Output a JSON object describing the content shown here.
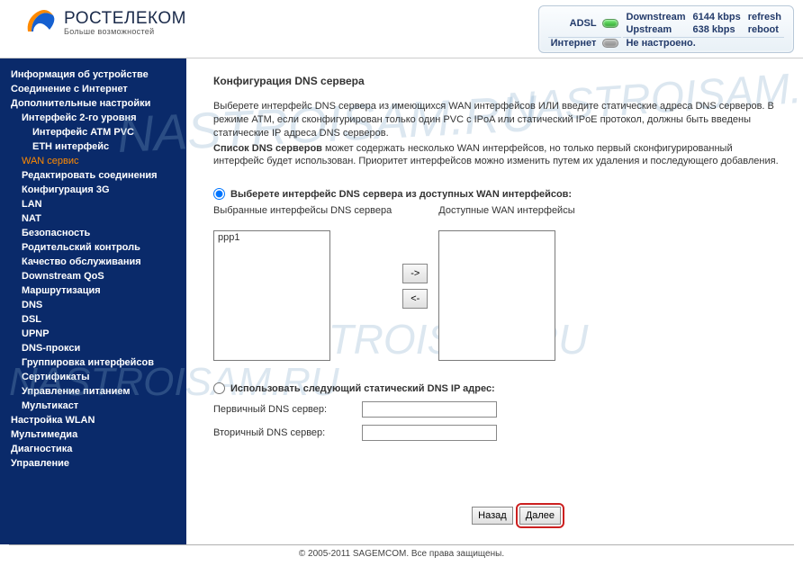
{
  "brand": {
    "title": "РОСТЕЛЕКОМ",
    "subtitle": "Больше возможностей"
  },
  "status": {
    "adsl_label": "ADSL",
    "downstream_label": "Downstream",
    "downstream_value": "6144 kbps",
    "upstream_label": "Upstream",
    "upstream_value": "638 kbps",
    "internet_label": "Интернет",
    "internet_value": "Не настроено.",
    "refresh": "refresh",
    "reboot": "reboot"
  },
  "sidebar": {
    "items": [
      {
        "label": "Информация об устройстве",
        "cls": "bold"
      },
      {
        "label": "Соединение с Интернет",
        "cls": "bold"
      },
      {
        "label": "Дополнительные настройки",
        "cls": "bold"
      },
      {
        "label": "Интерфейс 2-го уровня",
        "cls": "sub1"
      },
      {
        "label": "Интерфейс ATM PVC",
        "cls": "sub2"
      },
      {
        "label": "ETH интерфейс",
        "cls": "sub2"
      },
      {
        "label": "WAN сервис",
        "cls": "sub1 active"
      },
      {
        "label": "Редактировать соединения",
        "cls": "sub1"
      },
      {
        "label": "Конфигурация 3G",
        "cls": "sub1"
      },
      {
        "label": "LAN",
        "cls": "sub1"
      },
      {
        "label": "NAT",
        "cls": "sub1"
      },
      {
        "label": "Безопасность",
        "cls": "sub1"
      },
      {
        "label": "Родительский контроль",
        "cls": "sub1"
      },
      {
        "label": "Качество обслуживания",
        "cls": "sub1"
      },
      {
        "label": "Downstream QoS",
        "cls": "sub1"
      },
      {
        "label": "Маршрутизация",
        "cls": "sub1"
      },
      {
        "label": "DNS",
        "cls": "sub1"
      },
      {
        "label": "DSL",
        "cls": "sub1"
      },
      {
        "label": "UPNP",
        "cls": "sub1"
      },
      {
        "label": "DNS-прокси",
        "cls": "sub1"
      },
      {
        "label": "Группировка интерфейсов",
        "cls": "sub1"
      },
      {
        "label": "Сертификаты",
        "cls": "sub1"
      },
      {
        "label": "Управление питанием",
        "cls": "sub1"
      },
      {
        "label": "Мультикаст",
        "cls": "sub1"
      },
      {
        "label": "Настройка WLAN",
        "cls": "bold"
      },
      {
        "label": "Мультимедиа",
        "cls": "bold"
      },
      {
        "label": "Диагностика",
        "cls": "bold"
      },
      {
        "label": "Управление",
        "cls": "bold"
      }
    ]
  },
  "content": {
    "title": "Конфигурация DNS сервера",
    "para1": "Выберете интерфейс DNS сервера из имеющихся WAN интерфейсов ИЛИ введите статические адреса DNS серверов. В режиме ATM, если сконфигурирован только один PVC с IPoA или статический IPoE протокол, должны быть введены статические IP адреса DNS серверов.",
    "para2a": "Список DNS серверов",
    "para2b": " может содержать несколько WAN интерфейсов, но только первый сконфигурированный интерфейс будет использован. Приоритет интерфейсов можно изменить путем их удаления и последующего добавления.",
    "radio1": "Выберете интерфейс DNS сервера из доступных WAN интерфейсов:",
    "selected_head": "Выбранные интерфейсы DNS сервера",
    "available_head": "Доступные WAN интерфейсы",
    "selected_items": [
      "ppp1"
    ],
    "arrow_right": "->",
    "arrow_left": "<-",
    "radio2": "Использовать следующий статический DNS IP адрес:",
    "primary_label": "Первичный DNS сервер:",
    "secondary_label": "Вторичный DNS сервер:",
    "primary_value": "",
    "secondary_value": "",
    "back": "Назад",
    "next": "Далее"
  },
  "footer": "© 2005-2011 SAGEMCOM. Все права защищены.",
  "watermark": "NASTROISAM.RU"
}
